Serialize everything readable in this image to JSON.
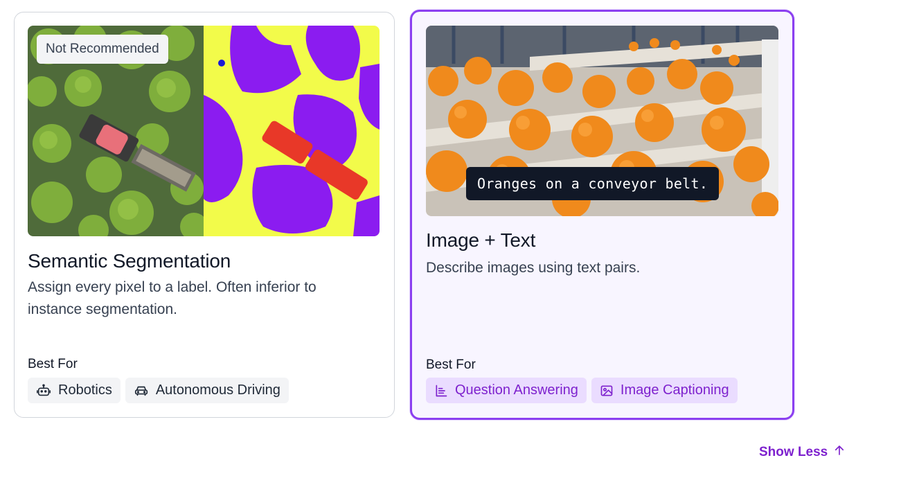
{
  "cards": [
    {
      "badge": "Not Recommended",
      "title": "Semantic Segmentation",
      "description": "Assign every pixel to a label. Often inferior to instance segmentation.",
      "best_for_label": "Best For",
      "tags": [
        {
          "label": "Robotics",
          "icon": "robot-icon"
        },
        {
          "label": "Autonomous Driving",
          "icon": "car-icon"
        }
      ]
    },
    {
      "caption": "Oranges on a conveyor belt.",
      "title": "Image + Text",
      "description": "Describe images using text pairs.",
      "best_for_label": "Best For",
      "tags": [
        {
          "label": "Question Answering",
          "icon": "chart-icon"
        },
        {
          "label": "Image Captioning",
          "icon": "image-icon"
        }
      ]
    }
  ],
  "footer": {
    "show_less_label": "Show Less",
    "icon": "arrow-up-icon"
  },
  "colors": {
    "accent": "#8b3ff0",
    "accent_text": "#7e22ce",
    "tag_purple_bg": "#eadcff"
  }
}
